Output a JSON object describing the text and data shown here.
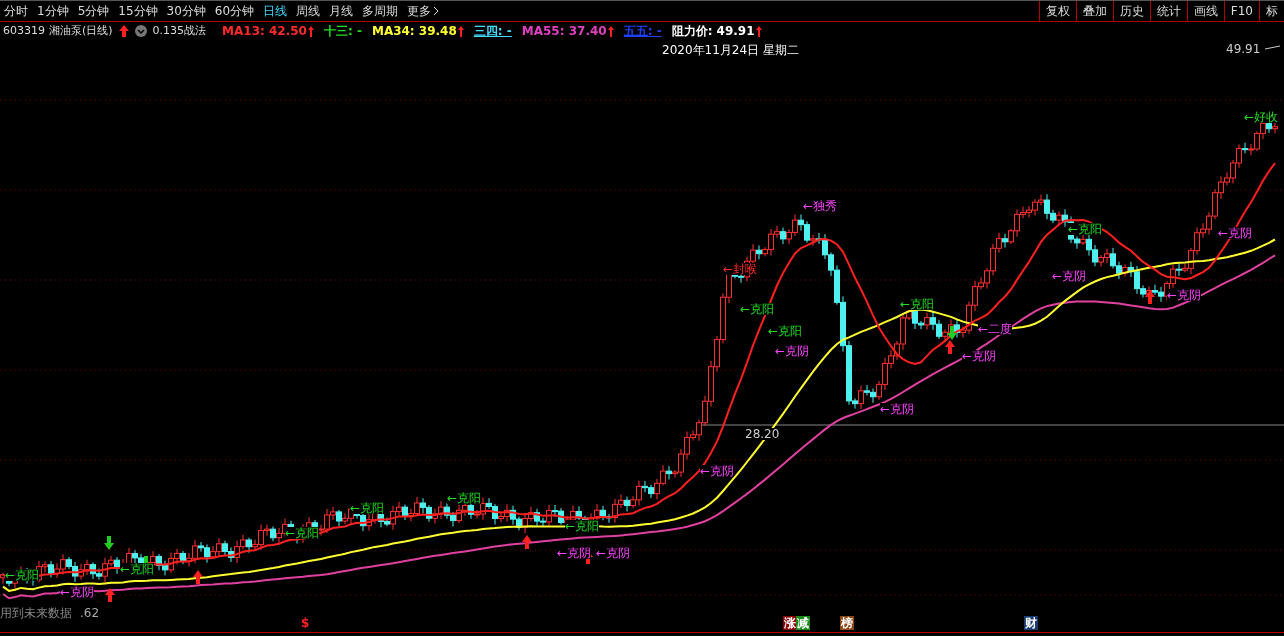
{
  "toolbar": {
    "periods": [
      {
        "label": "分时",
        "selected": false
      },
      {
        "label": "1分钟",
        "selected": false
      },
      {
        "label": "5分钟",
        "selected": false
      },
      {
        "label": "15分钟",
        "selected": false
      },
      {
        "label": "30分钟",
        "selected": false
      },
      {
        "label": "60分钟",
        "selected": false
      },
      {
        "label": "日线",
        "selected": true
      },
      {
        "label": "周线",
        "selected": false
      },
      {
        "label": "月线",
        "selected": false
      },
      {
        "label": "多周期",
        "selected": false
      }
    ],
    "more": "更多",
    "actions": [
      "复权",
      "叠加",
      "历史",
      "统计",
      "画线",
      "F10",
      "标"
    ]
  },
  "legend": {
    "code": "603319",
    "name": "湘油泵(日线)",
    "strategy": "0.135战法",
    "indicators": [
      {
        "label": "MA13: 42.50",
        "color": "#ff2a2a",
        "arrow": true,
        "underline": false
      },
      {
        "label": "十三: -",
        "color": "#22dd22",
        "arrow": false,
        "underline": false
      },
      {
        "label": "MA34: 39.48",
        "color": "#ffff33",
        "arrow": true,
        "underline": false
      },
      {
        "label": "三四: -",
        "color": "#44ddff",
        "arrow": false,
        "underline": true
      },
      {
        "label": "MA55: 37.40",
        "color": "#e040c0",
        "arrow": true,
        "underline": false
      },
      {
        "label": "五五: -",
        "color": "#2040ff",
        "arrow": false,
        "underline": true
      },
      {
        "label": "阻力价: 49.91",
        "color": "#ffffff",
        "arrow": true,
        "underline": false
      }
    ]
  },
  "chart": {
    "date": "2020年11月24日 星期二",
    "price_marker": "49.91",
    "crosshair_label": "28.20",
    "annotations": [
      {
        "text": "←独秀",
        "color": "#ff44ff"
      },
      {
        "text": "←封喉",
        "color": "#ff2a2a"
      },
      {
        "text": "←克阳",
        "color": "#22dd22"
      },
      {
        "text": "←克阳",
        "color": "#22dd22"
      },
      {
        "text": "←克阴",
        "color": "#ff44ff"
      },
      {
        "text": "←克阳",
        "color": "#22dd22"
      },
      {
        "text": "←克阳",
        "color": "#22dd22"
      },
      {
        "text": "←克阴",
        "color": "#ff44ff"
      },
      {
        "text": "←二度",
        "color": "#ff44ff"
      },
      {
        "text": "←克阴",
        "color": "#ff44ff"
      },
      {
        "text": "←克阴",
        "color": "#ff44ff"
      },
      {
        "text": "←克阴",
        "color": "#ff44ff"
      },
      {
        "text": "←克阴",
        "color": "#ff44ff"
      },
      {
        "text": "←好收",
        "color": "#22dd22"
      },
      {
        "text": "←克阳",
        "color": "#22dd22"
      },
      {
        "text": "←克阳",
        "color": "#22dd22"
      },
      {
        "text": "←克阳",
        "color": "#22dd22"
      },
      {
        "text": "←克阳",
        "color": "#22dd22"
      },
      {
        "text": "←克阴",
        "color": "#ff44ff"
      },
      {
        "text": "←克阴",
        "color": "#ff44ff"
      },
      {
        "text": "←克阳",
        "color": "#22dd22"
      },
      {
        "text": "←克阳",
        "color": "#22dd22"
      },
      {
        "text": "←克阴",
        "color": "#ff44ff"
      },
      {
        "text": "←克阴",
        "color": "#ff44ff"
      }
    ],
    "future_data_note": "用到未来数据",
    "low_label": ".62"
  },
  "bottom_tags": [
    {
      "text": "$",
      "color": "#ff2020"
    },
    {
      "text": "涨",
      "color": "#8b0000"
    },
    {
      "text": "减",
      "color": "#1a8a1a"
    },
    {
      "text": "榜",
      "color": "#8b4513"
    },
    {
      "text": "财",
      "color": "#163a6e"
    }
  ]
}
